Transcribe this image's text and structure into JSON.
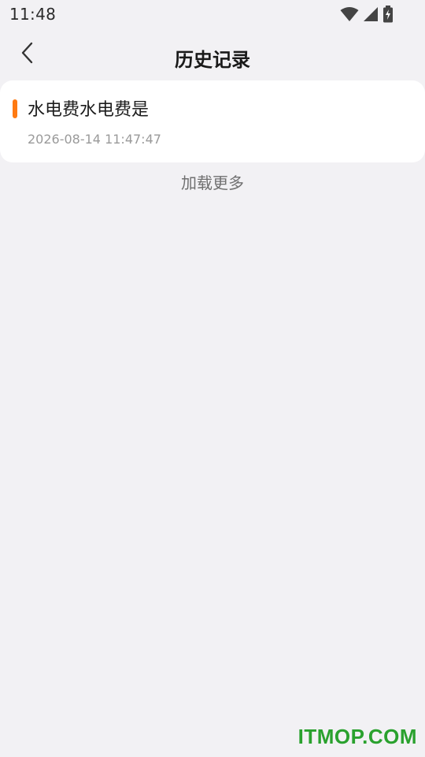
{
  "status_bar": {
    "time": "11:48",
    "icons": [
      "wifi-icon",
      "signal-icon",
      "battery-charging-icon"
    ]
  },
  "header": {
    "back_icon": "chevron-left-icon",
    "title": "历史记录"
  },
  "records": [
    {
      "title": "水电费水电费是",
      "timestamp": "2026-08-14 11:47:47",
      "accent_color": "#ff7a12"
    }
  ],
  "load_more_label": "加载更多",
  "watermark": "ITMOP.COM",
  "colors": {
    "background": "#f2f1f4",
    "card": "#ffffff",
    "accent": "#ff7a12",
    "watermark": "#2aa12e"
  }
}
